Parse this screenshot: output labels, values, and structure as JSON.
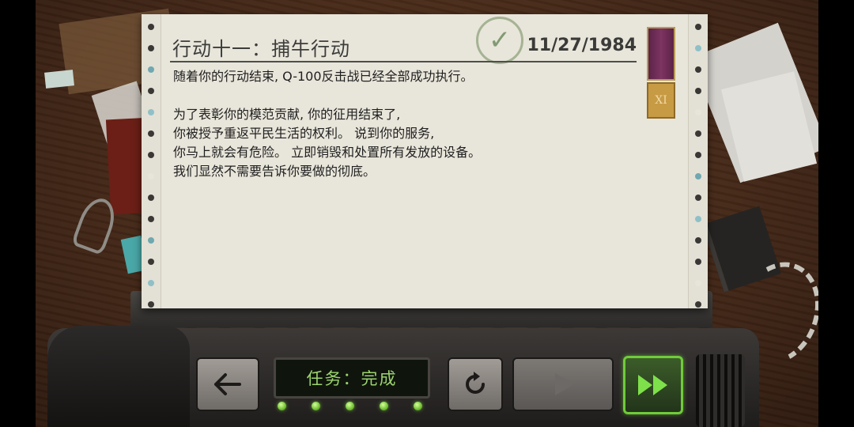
{
  "mission": {
    "title": "行动十一：捕牛行动",
    "date": "11/27/1984",
    "status_stamp": "✓",
    "body_lines": [
      "随着你的行动结束, Q-100反击战已经全部成功执行。",
      "",
      "为了表彰你的模范贡献, 你的征用结束了,",
      "你被授予重返平民生活的权利。 说到你的服务,",
      "你马上就会有危险。 立即销毁和处置所有发放的设备。",
      "我们显然不需要告诉你要做的彻底。"
    ]
  },
  "medal": {
    "numeral": "XI",
    "ribbon_color": "#6e2b55",
    "medal_color": "#c79a44"
  },
  "console": {
    "display_text": "任务：完成",
    "indicator_leds": 5,
    "accent_color": "#6fcc3a"
  },
  "icons": {
    "back": "arrow-left-icon",
    "reset": "refresh-icon",
    "play": "play-icon",
    "fast_forward": "fast-forward-icon"
  }
}
